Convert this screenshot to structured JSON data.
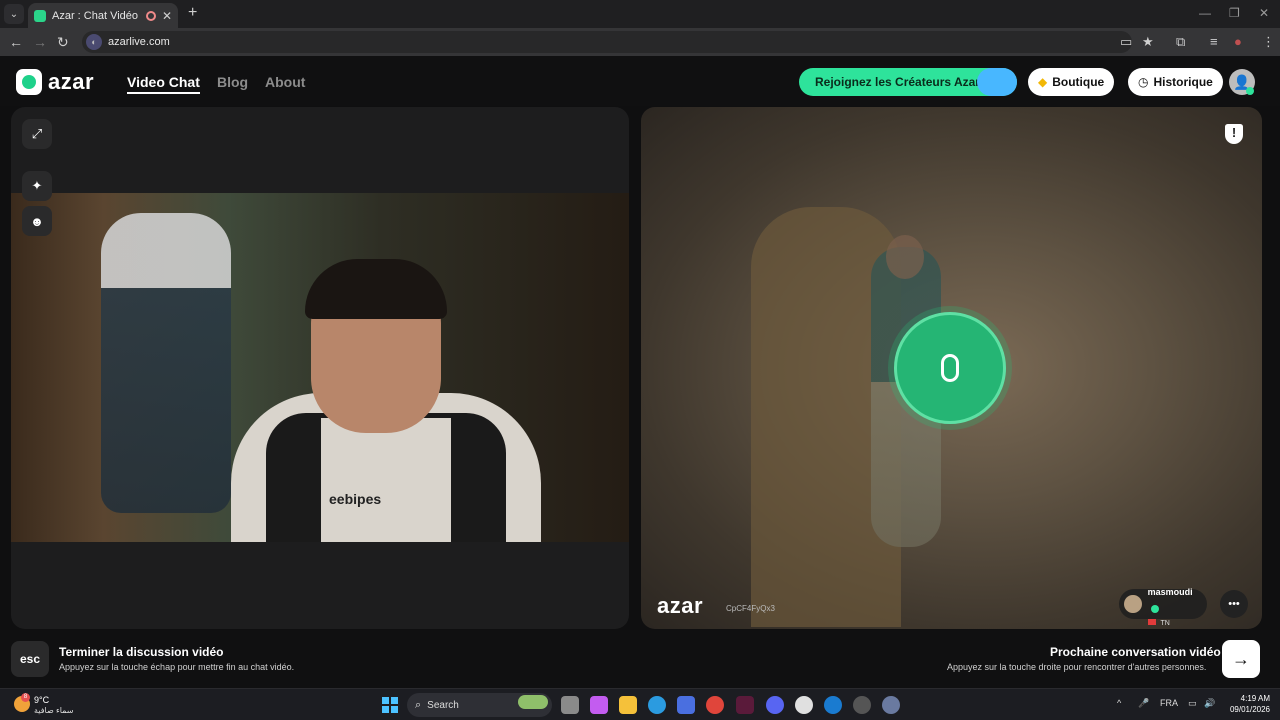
{
  "browser": {
    "tab_title": "Azar : Chat Vidéo avec de n",
    "tab_close": "✕",
    "new_tab": "+",
    "url": "azarlive.com"
  },
  "header": {
    "logo": "azar",
    "nav": [
      "Video Chat",
      "Blog",
      "About"
    ],
    "active_nav": "Video Chat",
    "creator_button": "Rejoignez les Créateurs Azar",
    "shop_button": "Boutique",
    "history_button": "Historique"
  },
  "local_video": {
    "shirt_text": "eebipes"
  },
  "remote_video": {
    "watermark_logo": "azar",
    "watermark_code": "CpCF4FyQx3",
    "user": {
      "name": "masmoudi",
      "country": "TN"
    },
    "report_icon": "!"
  },
  "bottom_bar": {
    "esc_key": "esc",
    "end_title": "Terminer la discussion vidéo",
    "end_subtitle": "Appuyez sur la touche échap pour mettre fin au chat vidéo.",
    "next_title": "Prochaine conversation vidéo",
    "next_subtitle": "Appuyez sur la touche droite pour rencontrer d'autres personnes.",
    "next_arrow": "→"
  },
  "taskbar": {
    "weather_temp": "9°C",
    "weather_desc": "سماء صافية",
    "weather_badge": "8",
    "search_placeholder": "Search",
    "language": "FRA",
    "time": "4:19 AM",
    "date": "09/01/2026"
  },
  "colors": {
    "accent": "#2ee39b",
    "mic_circle": "#25b574"
  }
}
